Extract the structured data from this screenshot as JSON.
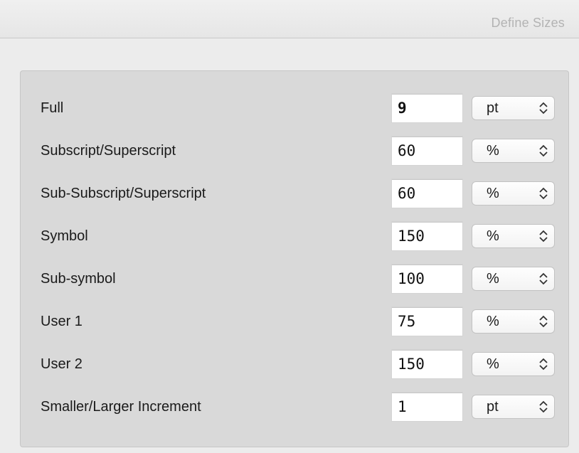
{
  "window": {
    "title": "Define Sizes"
  },
  "rows": [
    {
      "label": "Full",
      "value": "9",
      "unit": "pt"
    },
    {
      "label": "Subscript/Superscript",
      "value": "60",
      "unit": "%"
    },
    {
      "label": "Sub-Subscript/Superscript",
      "value": "60",
      "unit": "%"
    },
    {
      "label": "Symbol",
      "value": "150",
      "unit": "%"
    },
    {
      "label": "Sub-symbol",
      "value": "100",
      "unit": "%"
    },
    {
      "label": "User 1",
      "value": "75",
      "unit": "%"
    },
    {
      "label": "User 2",
      "value": "150",
      "unit": "%"
    },
    {
      "label": "Smaller/Larger Increment",
      "value": "1",
      "unit": "pt"
    }
  ],
  "icons": {
    "select_arrows": "up-down-chevron-icon"
  }
}
